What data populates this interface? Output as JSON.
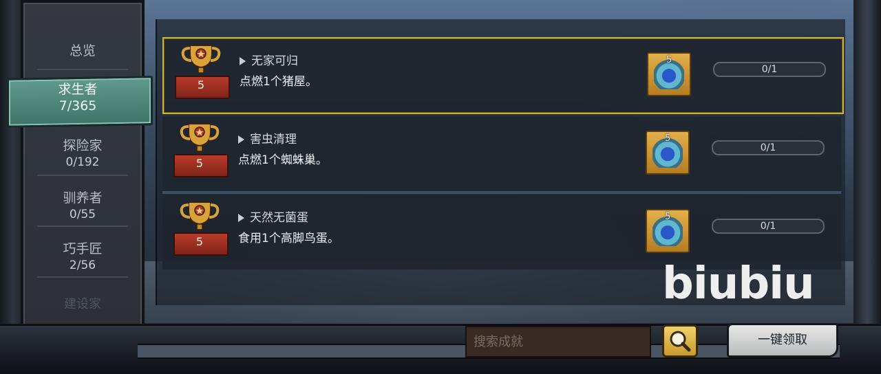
{
  "sidebar": {
    "items": [
      {
        "label": "总览",
        "count": ""
      },
      {
        "label": "求生者",
        "count": "7/365"
      },
      {
        "label": "探险家",
        "count": "0/192"
      },
      {
        "label": "驯养者",
        "count": "0/55"
      },
      {
        "label": "巧手匠",
        "count": "2/56"
      },
      {
        "label": "建设家",
        "count": ""
      }
    ],
    "active_index": 1
  },
  "achievements": [
    {
      "title": "无家可归",
      "desc": "点燃1个猪屋。",
      "trophy_points": "5",
      "reward_count": "5",
      "progress": "0/1",
      "selected": true
    },
    {
      "title": "害虫清理",
      "desc": "点燃1个蜘蛛巢。",
      "trophy_points": "5",
      "reward_count": "5",
      "progress": "0/1",
      "selected": false
    },
    {
      "title": "天然无菌蛋",
      "desc": "食用1个高脚鸟蛋。",
      "trophy_points": "5",
      "reward_count": "5",
      "progress": "0/1",
      "selected": false
    }
  ],
  "search": {
    "placeholder": "搜索成就"
  },
  "claim_all_label": "一键领取",
  "watermark": "biubiu",
  "colors": {
    "selected_border": "#cdb233",
    "active_tab": "#4f8a7c",
    "trophy_red": "#b83b2c",
    "reward_gold": "#e3b04b"
  },
  "icons": [
    "trophy-icon",
    "gem-reward-icon",
    "search-icon",
    "triangle-icon"
  ]
}
